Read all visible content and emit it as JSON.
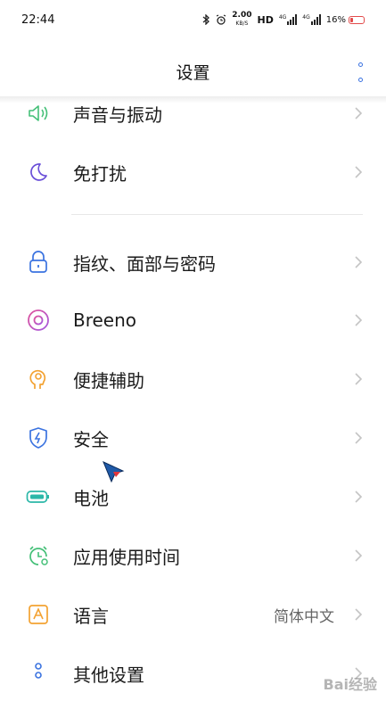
{
  "status_bar": {
    "time": "22:44",
    "net_speed": "2.00",
    "net_unit": "KB/S",
    "hd_label": "HD",
    "sig1": "4G",
    "sig2": "4G",
    "battery_pct": "16%",
    "battery_level": 0.16,
    "battery_color": "#e24b4b"
  },
  "header": {
    "title": "设置"
  },
  "settings": {
    "items": [
      {
        "label": "声音与振动",
        "value": "",
        "icon": "speaker-icon"
      },
      {
        "label": "免打扰",
        "value": "",
        "icon": "moon-icon"
      },
      {
        "label": "指纹、面部与密码",
        "value": "",
        "icon": "lock-icon"
      },
      {
        "label": "Breeno",
        "value": "",
        "icon": "breeno-icon"
      },
      {
        "label": "便捷辅助",
        "value": "",
        "icon": "assist-head-icon"
      },
      {
        "label": "安全",
        "value": "",
        "icon": "shield-icon"
      },
      {
        "label": "电池",
        "value": "",
        "icon": "battery-icon"
      },
      {
        "label": "应用使用时间",
        "value": "",
        "icon": "clock-icon"
      },
      {
        "label": "语言",
        "value": "简体中文",
        "icon": "language-icon"
      },
      {
        "label": "其他设置",
        "value": "",
        "icon": "other-dots-icon"
      }
    ]
  },
  "watermark": "Bai经验",
  "colors": {
    "accent": "#3b73e0",
    "green": "#45c078",
    "purple": "#6a4fd8",
    "blue": "#3b73e0",
    "pink": "#e0529a",
    "orange": "#f3a232",
    "teal": "#2bb7a8",
    "chevron": "#c4c4c4"
  }
}
